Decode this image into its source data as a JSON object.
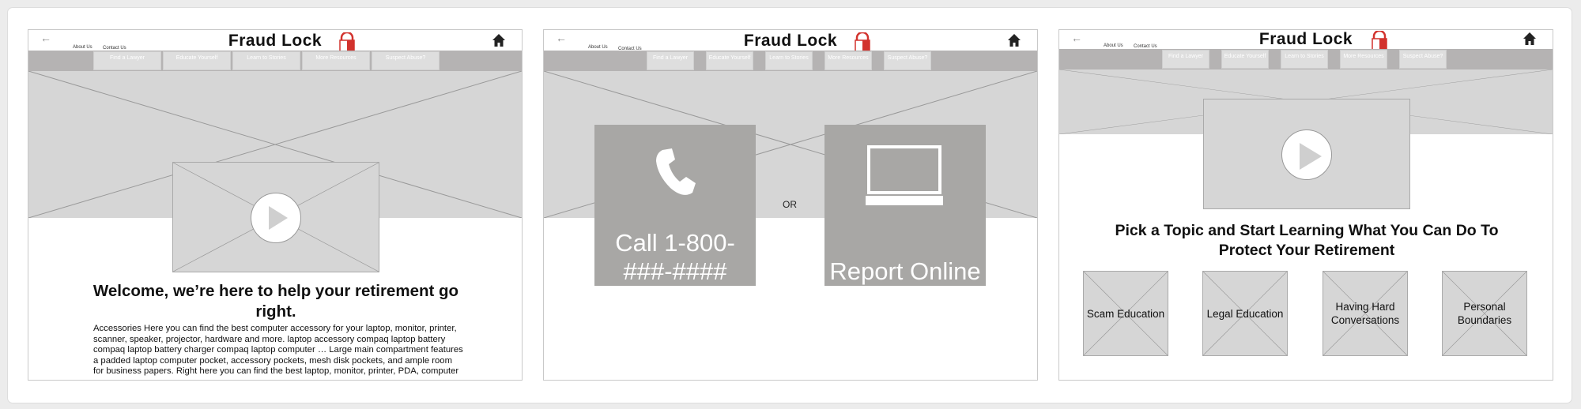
{
  "header": {
    "title": "Fraud Lock",
    "back_icon": "←",
    "about_label": "About Us",
    "contact_label": "Contact Us",
    "lock_icon": "padlock-logo-icon",
    "home_icon": "home-icon"
  },
  "nav_tabs_wide": [
    "Find a Lawyer",
    "Educate Yourself",
    "Learn to Stories",
    "More Resources",
    "Suspect Abuse?"
  ],
  "nav_tabs_narrow": [
    "Find a Lawyer",
    "Educate Yourself",
    "Learn to Stories",
    "More Resources",
    "Suspect Abuse?"
  ],
  "screen1": {
    "headline": "Welcome, we’re here to help your retirement go right.",
    "body": "Accessories Here you can find the best computer accessory for your laptop, monitor, printer, scanner, speaker, projector, hardware and more. laptop accessory compaq laptop battery compaq laptop battery charger compaq laptop computer … Large main compartment features a padded laptop computer pocket, accessory pockets, mesh disk pockets, and ample room for business papers. Right here you can find the best laptop, monitor, printer, PDA, computer"
  },
  "screen2": {
    "call_label": "Call 1-800-###-####",
    "or_label": "OR",
    "report_label": "Report Online",
    "phone_icon": "phone-icon",
    "laptop_icon": "laptop-icon"
  },
  "screen3": {
    "headline": "Pick a Topic and Start Learning What You Can Do To Protect Your Retirement",
    "topics": [
      "Scam Education",
      "Legal Education",
      "Having Hard Conversations",
      "Personal Boundaries"
    ]
  },
  "colors": {
    "nav_bar": "#b5b3b3",
    "placeholder": "#d6d6d6",
    "cta_tile": "#a8a7a5",
    "lock_red": "#d2322d"
  }
}
